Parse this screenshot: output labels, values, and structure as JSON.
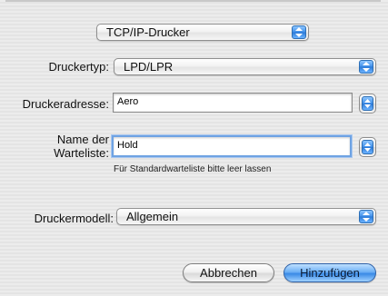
{
  "protocol_popup": {
    "value": "TCP/IP-Drucker"
  },
  "printer_type": {
    "label": "Druckertyp:",
    "value": "LPD/LPR"
  },
  "printer_address": {
    "label": "Druckeradresse:",
    "value": "Aero"
  },
  "queue_name": {
    "label_line1": "Name der",
    "label_line2": "Warteliste:",
    "value": "Hold",
    "hint": "Für Standardwarteliste bitte leer lassen"
  },
  "printer_model": {
    "label": "Druckermodell:",
    "value": "Allgemein"
  },
  "buttons": {
    "cancel": "Abbrechen",
    "add": "Hinzufügen"
  },
  "colors": {
    "accent": "#3a8ae6",
    "focus_ring": "#6fa3e3"
  }
}
